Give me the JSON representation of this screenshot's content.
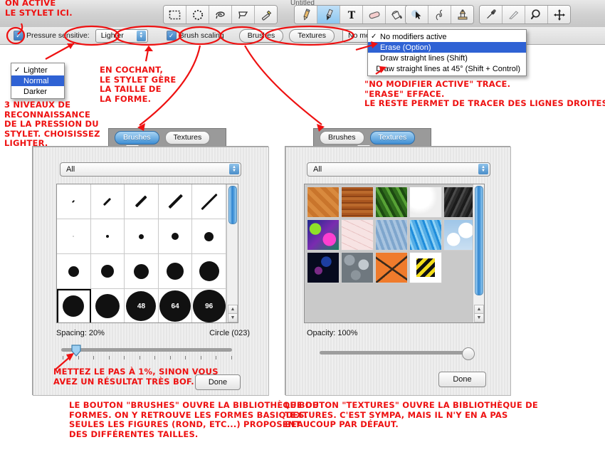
{
  "window": {
    "title": "Untitled"
  },
  "toolbar": {
    "groups": [
      {
        "name": "selection-tools",
        "tools": [
          {
            "name": "rectangular-marquee-icon",
            "label": "Rectangular marquee"
          },
          {
            "name": "elliptical-marquee-icon",
            "label": "Elliptical marquee"
          },
          {
            "name": "lasso-icon",
            "label": "Lasso"
          },
          {
            "name": "polygon-lasso-icon",
            "label": "Polygon lasso"
          },
          {
            "name": "magic-wand-icon",
            "label": "Magic wand"
          }
        ]
      },
      {
        "name": "paint-tools",
        "tools": [
          {
            "name": "pencil-icon",
            "label": "Pencil"
          },
          {
            "name": "paintbrush-icon",
            "label": "Paintbrush",
            "selected": true
          },
          {
            "name": "text-icon",
            "label": "Text"
          },
          {
            "name": "eraser-icon",
            "label": "Eraser"
          },
          {
            "name": "paint-bucket-icon",
            "label": "Paint bucket"
          },
          {
            "name": "gradient-icon",
            "label": "Gradient"
          }
        ]
      },
      {
        "name": "retouch-tools",
        "tools": [
          {
            "name": "arrow-select-icon",
            "label": "Move / select"
          },
          {
            "name": "smudge-icon",
            "label": "Smudge"
          },
          {
            "name": "clone-stamp-icon",
            "label": "Clone stamp"
          }
        ]
      },
      {
        "name": "utility-tools",
        "tools": [
          {
            "name": "eyedropper-icon",
            "label": "Eyedropper"
          },
          {
            "name": "blur-knife-icon",
            "label": "Blur knife"
          },
          {
            "name": "magnifier-icon",
            "label": "Zoom"
          },
          {
            "name": "move-hand-icon",
            "label": "Pan"
          }
        ]
      }
    ]
  },
  "options_bar": {
    "pressure_sensitive_label": "Pressure sensitive:",
    "pressure_checked": true,
    "pressure_value": "Lighter",
    "brush_scaling_label": "Brush scaling",
    "brush_scaling_checked": true,
    "brushes_button": "Brushes",
    "textures_button": "Textures",
    "modifier_value": "No modifiers active"
  },
  "pressure_menu": {
    "items": [
      {
        "label": "Lighter",
        "checked": true,
        "highlighted": false
      },
      {
        "label": "Normal",
        "checked": false,
        "highlighted": true
      },
      {
        "label": "Darker",
        "checked": false,
        "highlighted": false
      }
    ]
  },
  "modifier_menu": {
    "items": [
      {
        "label": "No modifiers active",
        "checked": true,
        "highlighted": false
      },
      {
        "label": "Erase (Option)",
        "checked": false,
        "highlighted": true
      },
      {
        "label": "Draw straight lines (Shift)",
        "checked": false,
        "highlighted": false
      },
      {
        "label": "Draw straight lines at 45° (Shift + Control)",
        "checked": false,
        "highlighted": false
      }
    ]
  },
  "brushes_panel": {
    "tab_brushes": "Brushes",
    "tab_textures": "Textures",
    "active_tab": "Brushes",
    "filter_value": "All",
    "spacing_label": "Spacing: 20%",
    "spacing_value": 20,
    "shape_label": "Circle (023)",
    "done_label": "Done",
    "brush_numbers": [
      "48",
      "64",
      "96"
    ]
  },
  "textures_panel": {
    "tab_brushes": "Brushes",
    "tab_textures": "Textures",
    "active_tab": "Textures",
    "filter_value": "All",
    "opacity_label": "Opacity: 100%",
    "opacity_value": 100,
    "done_label": "Done",
    "swatches": [
      {
        "name": "texture-parquet"
      },
      {
        "name": "texture-wood"
      },
      {
        "name": "texture-leaves"
      },
      {
        "name": "texture-white-plaster"
      },
      {
        "name": "texture-dark-rock"
      },
      {
        "name": "texture-psychedelic"
      },
      {
        "name": "texture-marble"
      },
      {
        "name": "texture-water"
      },
      {
        "name": "texture-blue-rain"
      },
      {
        "name": "texture-clouds"
      },
      {
        "name": "texture-dark-blue"
      },
      {
        "name": "texture-stones"
      },
      {
        "name": "texture-orange-cracks"
      },
      {
        "name": "texture-hazard-stripes"
      }
    ]
  },
  "annotations": {
    "stylus_activate": "On active\nle stylet ici.",
    "pressure_levels": "3 niveaux de\nreconnaissance\nde la pression du\nstylet. Choisissez\nLighter.",
    "brush_scaling": "En cochant,\nle stylet gère\nla taille de\nla forme.",
    "modifiers": "\"No modifier active\" trace.\n\"Erase\" efface.\nLe reste permet de tracer des lignes droites.",
    "spacing_tip": "Mettez le pas à 1%, sinon vous\navez un résultat très bof.",
    "brushes_desc": "Le bouton \"Brushes\" ouvre la bibliothèque de\nformes. On y retrouve les formes basiques.\nSeules les figures (rond, etc...) proposent\ndes différentes tailles.",
    "textures_desc": "Le bouton \"Textures\" ouvre la bibliothèque de\ntextures. C'est sympa, mais il n'y en a pas\nbeaucoup par défaut."
  },
  "colors": {
    "annotation_red": "#ee1111",
    "selection_blue": "#2f62d4",
    "tab_active_blue": "#3f8fd4"
  }
}
